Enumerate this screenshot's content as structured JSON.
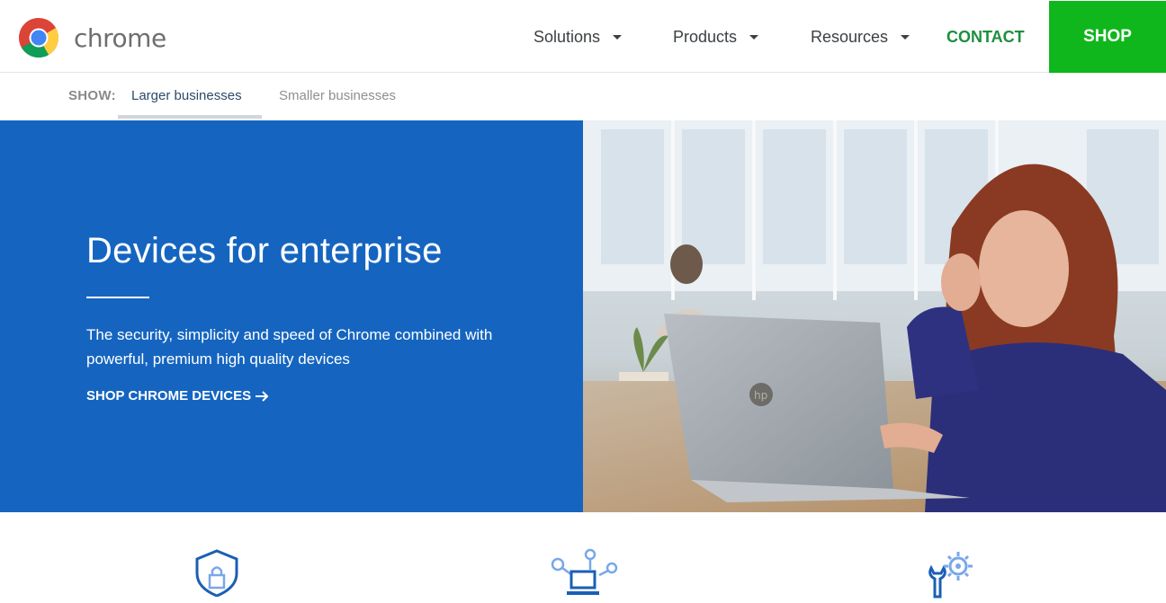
{
  "header": {
    "logo_text": "chrome",
    "nav": {
      "solutions": "Solutions",
      "products": "Products",
      "resources": "Resources",
      "contact": "CONTACT"
    },
    "shop_label": "SHOP"
  },
  "subnav": {
    "show_label": "SHOW:",
    "tabs": [
      {
        "label": "Larger businesses",
        "active": true
      },
      {
        "label": "Smaller businesses",
        "active": false
      }
    ]
  },
  "hero": {
    "title": "Devices for enterprise",
    "description": "The security, simplicity and speed of Chrome combined with powerful, premium high quality devices",
    "cta_label": "SHOP CHROME DEVICES",
    "image": "woman-using-hp-chromebook-laptop",
    "laptop_logo": "hp"
  },
  "features": {
    "icons": [
      "shield-lock-icon",
      "laptop-network-icon",
      "wrench-gear-icon"
    ]
  },
  "colors": {
    "brand_blue": "#1565c0",
    "shop_green": "#0fb71d",
    "contact_green": "#1e8e3e"
  }
}
